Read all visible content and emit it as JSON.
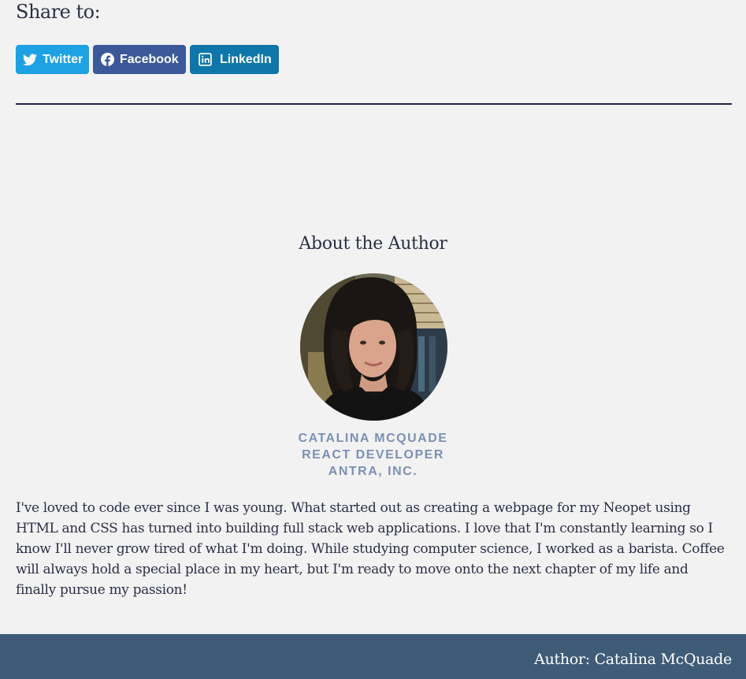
{
  "share": {
    "heading": "Share to:",
    "buttons": [
      {
        "label": "Twitter",
        "icon": "twitter-icon",
        "color": "#1da1e2"
      },
      {
        "label": "Facebook",
        "icon": "facebook-icon",
        "color": "#3b5999"
      },
      {
        "label": "LinkedIn",
        "icon": "linkedin-icon",
        "color": "#0e76a8"
      }
    ]
  },
  "about": {
    "heading": "About the Author",
    "name": "CATALINA MCQUADE",
    "role": "REACT DEVELOPER",
    "company": "ANTRA, INC.",
    "bio": "I've loved to code ever since I was young. What started out as creating a webpage for my Neopet using HTML and CSS has turned into building full stack web applications. I love that I'm constantly learning so I know I'll never grow tired of what I'm doing. While studying computer science, I worked as a barista. Coffee will always hold a special place in my heart, but I'm ready to move onto the next chapter of my life and finally pursue my passion!"
  },
  "footer": {
    "text": "Author: Catalina McQuade",
    "color": "#3e5c78"
  },
  "colors": {
    "background": "#f2f2f2",
    "divider": "#1e2146",
    "meta_text": "#7b91b4"
  }
}
